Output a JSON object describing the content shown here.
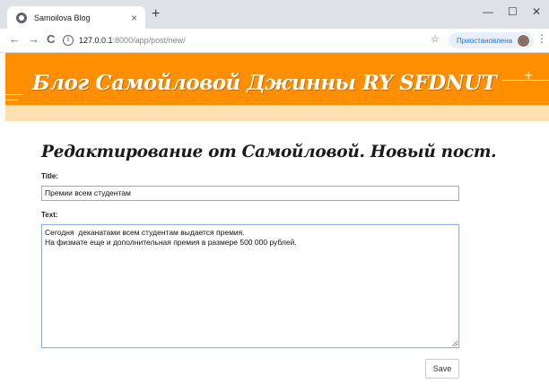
{
  "browser": {
    "tab_title": "Samoilova Blog",
    "tab_close_glyph": "×",
    "new_tab_glyph": "+",
    "minimize_glyph": "—",
    "maximize_glyph": "☐",
    "close_glyph": "✕",
    "back_glyph": "←",
    "forward_glyph": "→",
    "reload_glyph": "C",
    "url_host": "127.0.0.1",
    "url_path": ":8000/app/post/new/",
    "star_glyph": "☆",
    "profile_status": "Приостановлена",
    "menu_glyph": "⋮"
  },
  "site": {
    "title": "Блог Самойловой Джинны RY SFDNUT",
    "plus_glyph": "+",
    "header_color": "#ff8f00"
  },
  "form": {
    "heading": "Редактирование от Самойловой. Новый пост.",
    "title_label": "Title:",
    "title_value": "Премии всем студентам",
    "text_label": "Text:",
    "text_value": "Сегодня  деканатами всем студентам выдается премия.\nНа физмате еще и дополнительная премия в размере 500 000 рублей.",
    "save_label": "Save"
  }
}
